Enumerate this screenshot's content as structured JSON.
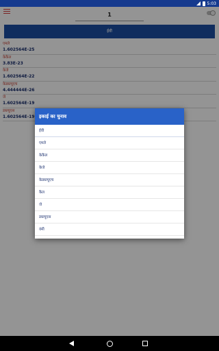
{
  "status_bar": {
    "time": "5:03"
  },
  "header": {
    "value": "1"
  },
  "unit_bar": {
    "label": "ईवी"
  },
  "results": [
    {
      "unit": "एमले",
      "value": "1.602564E-25"
    },
    {
      "unit": "केकैल",
      "value": "3.83E-23"
    },
    {
      "unit": "केजे",
      "value": "1.602564E-22"
    },
    {
      "unit": "केडब्ल्यूएच",
      "value": "4.444444E-26"
    },
    {
      "unit": "जे",
      "value": "1.602564E-19"
    },
    {
      "unit": "डब्ल्यूएस",
      "value": "1.602564E-19"
    }
  ],
  "dialog": {
    "title": "इकाई का चुनाव",
    "options": [
      "ईवी",
      "एमले",
      "केकैल",
      "केजे",
      "केडब्ल्यूएच",
      "कैल",
      "जे",
      "डब्ल्यूएस",
      "वंमी"
    ]
  }
}
